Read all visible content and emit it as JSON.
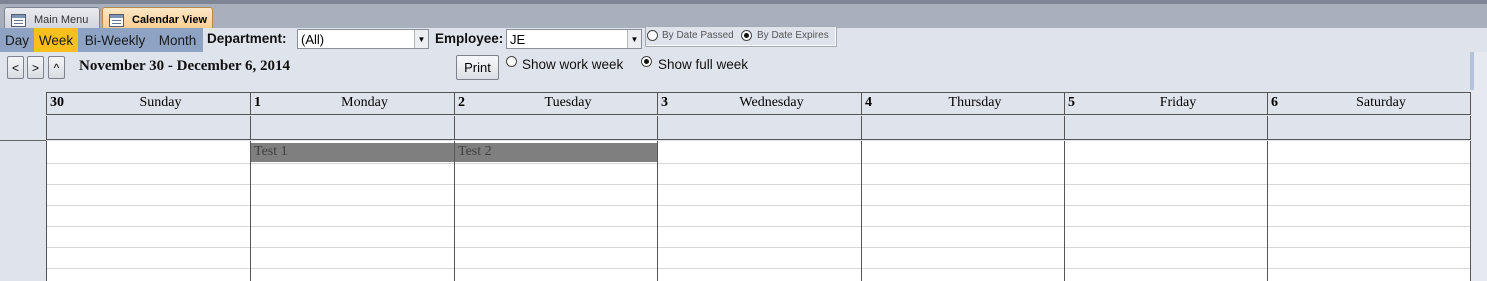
{
  "tabs": [
    {
      "label": "Main Menu",
      "active": false
    },
    {
      "label": "Calendar View",
      "active": true
    }
  ],
  "view_buttons": [
    {
      "label": "Day",
      "selected": false
    },
    {
      "label": "Week",
      "selected": true
    },
    {
      "label": "Bi-Weekly",
      "selected": false
    },
    {
      "label": "Month",
      "selected": false
    }
  ],
  "filters": {
    "department_label": "Department:",
    "department_value": "(All)",
    "employee_label": "Employee:",
    "employee_value": "JE"
  },
  "date_options": {
    "passed_label": "By Date Passed",
    "expires_label": "By Date Expires",
    "selected": "expires"
  },
  "nav": {
    "prev": "<",
    "next": ">",
    "up": "^"
  },
  "range_title": "November 30 - December 6, 2014",
  "print_label": "Print",
  "week_options": {
    "work_week_label": "Show work week",
    "full_week_label": "Show full week",
    "selected": "full"
  },
  "days": [
    {
      "num": "30",
      "name": "Sunday"
    },
    {
      "num": "1",
      "name": "Monday"
    },
    {
      "num": "2",
      "name": "Tuesday"
    },
    {
      "num": "3",
      "name": "Wednesday"
    },
    {
      "num": "4",
      "name": "Thursday"
    },
    {
      "num": "5",
      "name": "Friday"
    },
    {
      "num": "6",
      "name": "Saturday"
    }
  ],
  "appointments": [
    {
      "title": "Test 1",
      "day": "Monday"
    },
    {
      "title": "Test 2",
      "day": "Tuesday"
    }
  ],
  "colors": {
    "selected_view": "#f8c01c",
    "view_button": "#8ea3c4",
    "panel": "#dfe3ec",
    "appointment": "#7f7f7f"
  }
}
